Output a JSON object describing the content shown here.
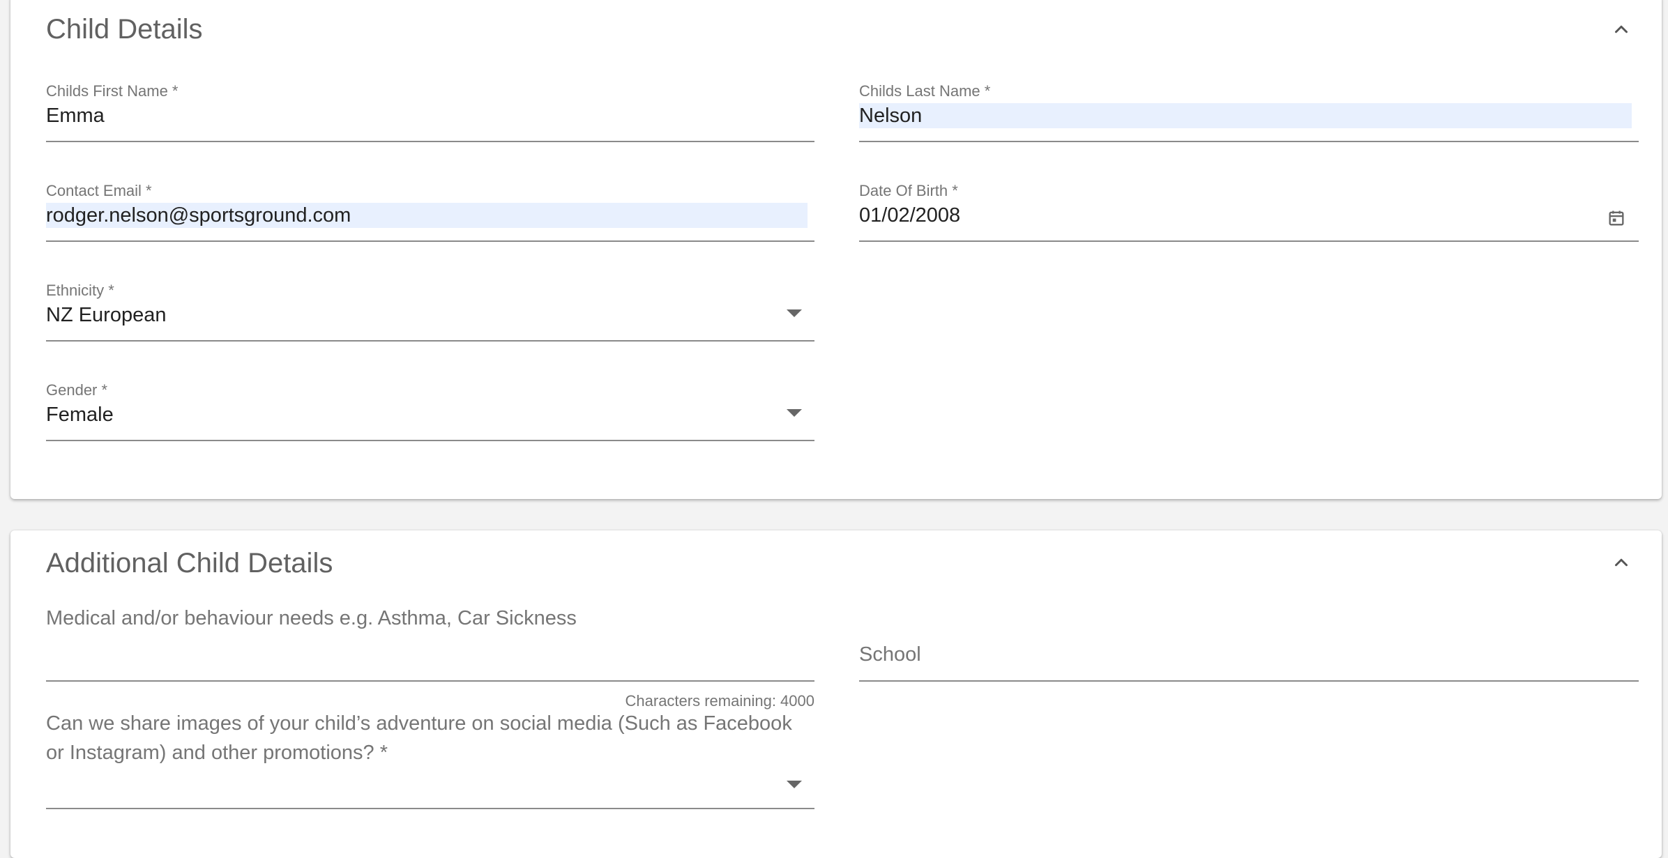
{
  "child_details": {
    "title": "Child Details",
    "first_name": {
      "label": "Childs First Name *",
      "value": "Emma"
    },
    "last_name": {
      "label": "Childs Last Name *",
      "value": "Nelson"
    },
    "email": {
      "label": "Contact Email *",
      "value": "rodger.nelson@sportsground.com"
    },
    "dob": {
      "label": "Date Of Birth *",
      "value": "01/02/2008"
    },
    "ethnicity": {
      "label": "Ethnicity *",
      "value": "NZ European"
    },
    "gender": {
      "label": "Gender *",
      "value": "Female"
    }
  },
  "additional_details": {
    "title": "Additional Child Details",
    "medical": {
      "placeholder": "Medical and/or behaviour needs e.g. Asthma, Car Sickness",
      "hint": "Characters remaining: 4000"
    },
    "school": {
      "placeholder": "School"
    },
    "social_media": {
      "label_line1": "Can we share images of your child’s adventure on social media (Such as Facebook",
      "label_line2": "or Instagram) and other promotions? *"
    }
  },
  "icons": {
    "collapse": "chevron-up-icon",
    "dropdown": "arrow-drop-down-icon",
    "calendar": "calendar-icon"
  }
}
